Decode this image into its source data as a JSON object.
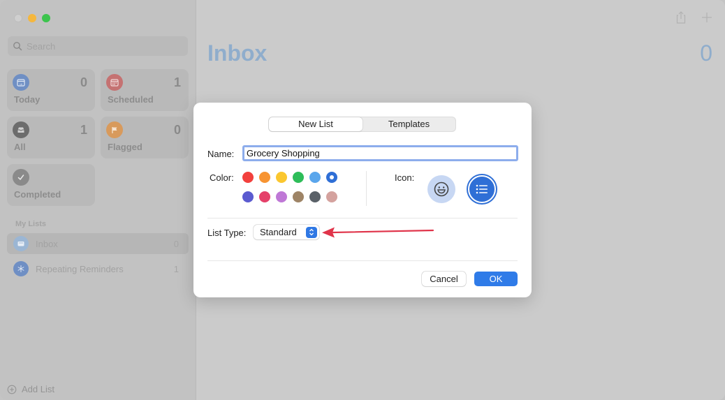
{
  "sidebar": {
    "search": {
      "placeholder": "Search",
      "value": ""
    },
    "smart_lists": [
      {
        "label": "Today",
        "count": "0",
        "icon": "calendar-today-icon",
        "color": "#6f8fc4"
      },
      {
        "label": "Scheduled",
        "count": "1",
        "icon": "calendar-icon",
        "color": "#c57272"
      },
      {
        "label": "All",
        "count": "1",
        "icon": "tray-icon",
        "color": "#6c6c6c"
      },
      {
        "label": "Flagged",
        "count": "0",
        "icon": "flag-icon",
        "color": "#d89a5c"
      },
      {
        "label": "Completed",
        "count": "",
        "icon": "checkmark-icon",
        "color": "#8a8a8a"
      }
    ],
    "my_lists_header": "My Lists",
    "lists": [
      {
        "name": "Inbox",
        "count": "0",
        "icon": "inbox-icon",
        "color": "#9bb6d4",
        "selected": true
      },
      {
        "name": "Repeating Reminders",
        "count": "1",
        "icon": "snowflake-icon",
        "color": "#6f8fc4",
        "selected": false
      }
    ],
    "add_list_label": "Add List"
  },
  "main": {
    "title": "Inbox",
    "count": "0",
    "toolbar": [
      "share-icon",
      "plus-icon"
    ]
  },
  "dialog": {
    "tabs": [
      {
        "label": "New List",
        "active": true
      },
      {
        "label": "Templates",
        "active": false
      }
    ],
    "name_label": "Name:",
    "name_value": "Grocery Shopping",
    "color_label": "Color:",
    "colors": [
      {
        "name": "red",
        "hex": "#f2403d",
        "selected": false
      },
      {
        "name": "orange",
        "hex": "#f79432",
        "selected": false
      },
      {
        "name": "yellow",
        "hex": "#fbc72f",
        "selected": false
      },
      {
        "name": "green",
        "hex": "#2ebd59",
        "selected": false
      },
      {
        "name": "light-blue",
        "hex": "#5aa6ec",
        "selected": false
      },
      {
        "name": "blue",
        "hex": "#2f6fd6",
        "selected": true
      },
      {
        "name": "indigo",
        "hex": "#5b5bd0",
        "selected": false
      },
      {
        "name": "pink",
        "hex": "#e5406a",
        "selected": false
      },
      {
        "name": "purple",
        "hex": "#bf78d6",
        "selected": false
      },
      {
        "name": "brown",
        "hex": "#9e8466",
        "selected": false
      },
      {
        "name": "dark-gray",
        "hex": "#5a6168",
        "selected": false
      },
      {
        "name": "rose-gray",
        "hex": "#d4a29e",
        "selected": false
      }
    ],
    "icon_label": "Icon:",
    "icon_options": [
      {
        "name": "emoji",
        "selected": false
      },
      {
        "name": "list",
        "selected": true
      }
    ],
    "list_type_label": "List Type:",
    "list_type_value": "Standard",
    "cancel_label": "Cancel",
    "ok_label": "OK"
  },
  "annotation": {
    "type": "arrow",
    "color": "#e0344a",
    "points_to": "list-type-select"
  }
}
